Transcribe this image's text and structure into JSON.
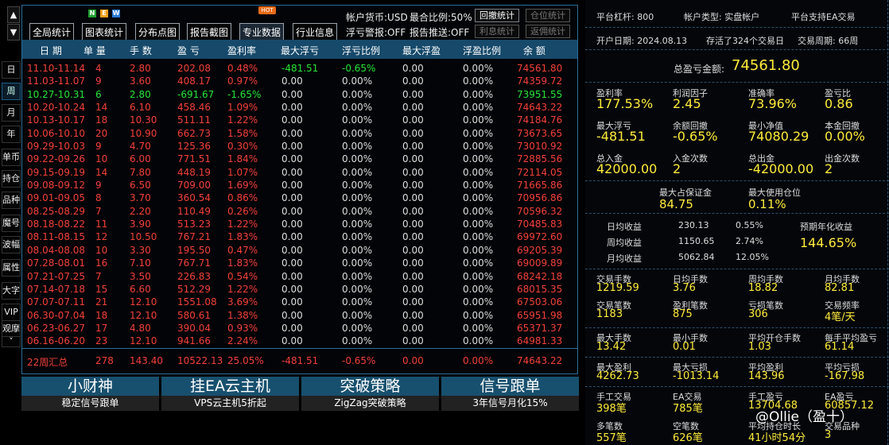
{
  "sidebar": {
    "arrow_up": "▲",
    "arrow_down": "▼",
    "tabs": [
      "日",
      "周",
      "月",
      "年",
      "单币",
      "持仓",
      "品种",
      "魔号",
      "波幅",
      "属性",
      "大字",
      "VIP",
      "观摩",
      "˅"
    ]
  },
  "toolbar": {
    "buttons": [
      "全局统计",
      "图表统计",
      "分布点图",
      "报告截图",
      "专业数据",
      "行业信息"
    ],
    "new_badge": [
      "N",
      "E",
      "W"
    ],
    "hot_badge": "HOT",
    "currency": "帐户货币:USD",
    "max_ratio": "最合比例:50%",
    "float_alert": "浮亏警报:OFF",
    "report_push": "报告推送:OFF",
    "small_buttons": [
      "回撤统计",
      "仓位统计",
      "利息统计",
      "返佣统计"
    ]
  },
  "table": {
    "headers": [
      "日 期",
      "单 量",
      "手 数",
      "盈 亏",
      "盈利率",
      "最大浮亏",
      "浮亏比例",
      "最大浮盈",
      "浮盈比例",
      "余 额"
    ],
    "rows": [
      [
        "11.10-11.14",
        "4",
        "2.80",
        "202.08",
        "0.48%",
        "-481.51",
        "-0.65%",
        "0.00",
        "0.00%",
        "74561.80",
        "r"
      ],
      [
        "11.03-11.07",
        "9",
        "3.60",
        "408.17",
        "0.97%",
        "0.00",
        "0.00%",
        "0.00",
        "0.00%",
        "74359.72",
        "r"
      ],
      [
        "10.27-10.31",
        "6",
        "2.80",
        "-691.67",
        "-1.65%",
        "0.00",
        "0.00%",
        "0.00",
        "0.00%",
        "73951.55",
        "g"
      ],
      [
        "10.20-10.24",
        "14",
        "6.10",
        "458.46",
        "1.09%",
        "0.00",
        "0.00%",
        "0.00",
        "0.00%",
        "74643.22",
        "r"
      ],
      [
        "10.13-10.17",
        "18",
        "10.30",
        "511.11",
        "1.22%",
        "0.00",
        "0.00%",
        "0.00",
        "0.00%",
        "74184.76",
        "r"
      ],
      [
        "10.06-10.10",
        "20",
        "10.90",
        "662.73",
        "1.58%",
        "0.00",
        "0.00%",
        "0.00",
        "0.00%",
        "73673.65",
        "r"
      ],
      [
        "09.29-10.03",
        "9",
        "4.70",
        "125.36",
        "0.30%",
        "0.00",
        "0.00%",
        "0.00",
        "0.00%",
        "73010.92",
        "r"
      ],
      [
        "09.22-09.26",
        "10",
        "6.00",
        "771.51",
        "1.84%",
        "0.00",
        "0.00%",
        "0.00",
        "0.00%",
        "72885.56",
        "r"
      ],
      [
        "09.15-09.19",
        "14",
        "7.80",
        "448.19",
        "1.07%",
        "0.00",
        "0.00%",
        "0.00",
        "0.00%",
        "72114.05",
        "r"
      ],
      [
        "09.08-09.12",
        "9",
        "6.50",
        "709.00",
        "1.69%",
        "0.00",
        "0.00%",
        "0.00",
        "0.00%",
        "71665.86",
        "r"
      ],
      [
        "09.01-09.05",
        "8",
        "3.70",
        "360.54",
        "0.86%",
        "0.00",
        "0.00%",
        "0.00",
        "0.00%",
        "70956.86",
        "r"
      ],
      [
        "08.25-08.29",
        "7",
        "2.20",
        "110.49",
        "0.26%",
        "0.00",
        "0.00%",
        "0.00",
        "0.00%",
        "70596.32",
        "r"
      ],
      [
        "08.18-08.22",
        "11",
        "3.90",
        "513.23",
        "1.22%",
        "0.00",
        "0.00%",
        "0.00",
        "0.00%",
        "70485.83",
        "r"
      ],
      [
        "08.11-08.15",
        "12",
        "10.50",
        "767.21",
        "1.83%",
        "0.00",
        "0.00%",
        "0.00",
        "0.00%",
        "69972.60",
        "r"
      ],
      [
        "08.04-08.08",
        "10",
        "3.30",
        "195.50",
        "0.47%",
        "0.00",
        "0.00%",
        "0.00",
        "0.00%",
        "69205.39",
        "r"
      ],
      [
        "07.28-08.01",
        "16",
        "7.10",
        "767.71",
        "1.83%",
        "0.00",
        "0.00%",
        "0.00",
        "0.00%",
        "69009.89",
        "r"
      ],
      [
        "07.21-07.25",
        "7",
        "3.50",
        "226.83",
        "0.54%",
        "0.00",
        "0.00%",
        "0.00",
        "0.00%",
        "68242.18",
        "r"
      ],
      [
        "07.14-07.18",
        "15",
        "6.60",
        "512.29",
        "1.22%",
        "0.00",
        "0.00%",
        "0.00",
        "0.00%",
        "68015.35",
        "r"
      ],
      [
        "07.07-07.11",
        "21",
        "12.10",
        "1551.08",
        "3.69%",
        "0.00",
        "0.00%",
        "0.00",
        "0.00%",
        "67503.06",
        "r"
      ],
      [
        "06.30-07.04",
        "18",
        "12.10",
        "580.61",
        "1.38%",
        "0.00",
        "0.00%",
        "0.00",
        "0.00%",
        "65951.98",
        "r"
      ],
      [
        "06.23-06.27",
        "17",
        "4.80",
        "390.04",
        "0.93%",
        "0.00",
        "0.00%",
        "0.00",
        "0.00%",
        "65371.37",
        "r"
      ],
      [
        "06.16-06.20",
        "23",
        "12.10",
        "941.66",
        "2.24%",
        "0.00",
        "0.00%",
        "0.00",
        "0.00%",
        "64981.33",
        "r"
      ]
    ],
    "summary": [
      "22周汇总",
      "278",
      "143.40",
      "10522.13",
      "25.05%",
      "-481.51",
      "-0.65%",
      "0.00",
      "0.00%",
      "74643.22"
    ]
  },
  "ads": [
    {
      "title": "小财神",
      "sub": "稳定信号跟单"
    },
    {
      "title": "挂EA云主机",
      "sub": "VPS云主机5折起"
    },
    {
      "title": "突破策略",
      "sub": "ZigZag突破策略"
    },
    {
      "title": "信号跟单",
      "sub": "3年信号月化15%"
    }
  ],
  "right": {
    "leverage": "平台杠杆:  800",
    "acct_type": "帐户类型:  实盘帐户",
    "ea_support": "平台支持EA交易",
    "open_date": "开户日期:  2024.08.13",
    "alive": "存活了324个交易日",
    "cycle": "交易周期:  66周",
    "total_label": "总盈亏金额:",
    "total_value": "74561.80",
    "grid1": [
      [
        "盈利率",
        "177.53%"
      ],
      [
        "利润因子",
        "2.45"
      ],
      [
        "准确率",
        "73.96%"
      ],
      [
        "盈亏比",
        "0.86"
      ],
      [
        "最大浮亏",
        "-481.51"
      ],
      [
        "余额回撤",
        "-0.65%"
      ],
      [
        "最小净值",
        "74080.29"
      ],
      [
        "本金回撤",
        "0.00%"
      ],
      [
        "总入金",
        "42000.00"
      ],
      [
        "入金次数",
        "2"
      ],
      [
        "总出金",
        "-42000.00"
      ],
      [
        "出金次数",
        "2"
      ]
    ],
    "margin_label": "最大占保证金",
    "margin_value": "84.75",
    "position_label": "最大使用仓位",
    "position_value": "0.11%",
    "daily": [
      "日均收益",
      "230.13",
      "0.55%"
    ],
    "weekly": [
      "周均收益",
      "1150.65",
      "2.74%"
    ],
    "monthly": [
      "月均收益",
      "5062.84",
      "12.05%"
    ],
    "annual_label": "预期年化收益",
    "annual_value": "144.65%",
    "grid2": [
      [
        "交易手数",
        "1219.59"
      ],
      [
        "日均手数",
        "3.76"
      ],
      [
        "周均手数",
        "18.82"
      ],
      [
        "月均手数",
        "82.81"
      ],
      [
        "交易笔数",
        "1183"
      ],
      [
        "盈利笔数",
        "875"
      ],
      [
        "亏损笔数",
        "306"
      ],
      [
        "交易频率",
        "4笔/天"
      ]
    ],
    "grid3": [
      [
        "最大手数",
        "13.42"
      ],
      [
        "最小手数",
        "0.01"
      ],
      [
        "平均开仓手数",
        "1.03"
      ],
      [
        "每手平均盈亏",
        "61.14"
      ]
    ],
    "grid4": [
      [
        "最大盈利",
        "4262.73"
      ],
      [
        "最大亏损",
        "-1013.14"
      ],
      [
        "平均盈利",
        "143.96"
      ],
      [
        "平均亏损",
        "-167.98"
      ]
    ],
    "grid5": [
      [
        "手工交易",
        "398笔"
      ],
      [
        "EA交易",
        "785笔"
      ],
      [
        "手工盈亏",
        "13704.68"
      ],
      [
        "EA盈亏",
        "60857.12"
      ],
      [
        "多笔数",
        "557笔"
      ],
      [
        "空笔数",
        "626笔"
      ],
      [
        "平均持仓时长",
        "41小时54分"
      ],
      [
        "交易品种",
        "3"
      ]
    ],
    "watermark": "@Ollie（盈十）"
  }
}
